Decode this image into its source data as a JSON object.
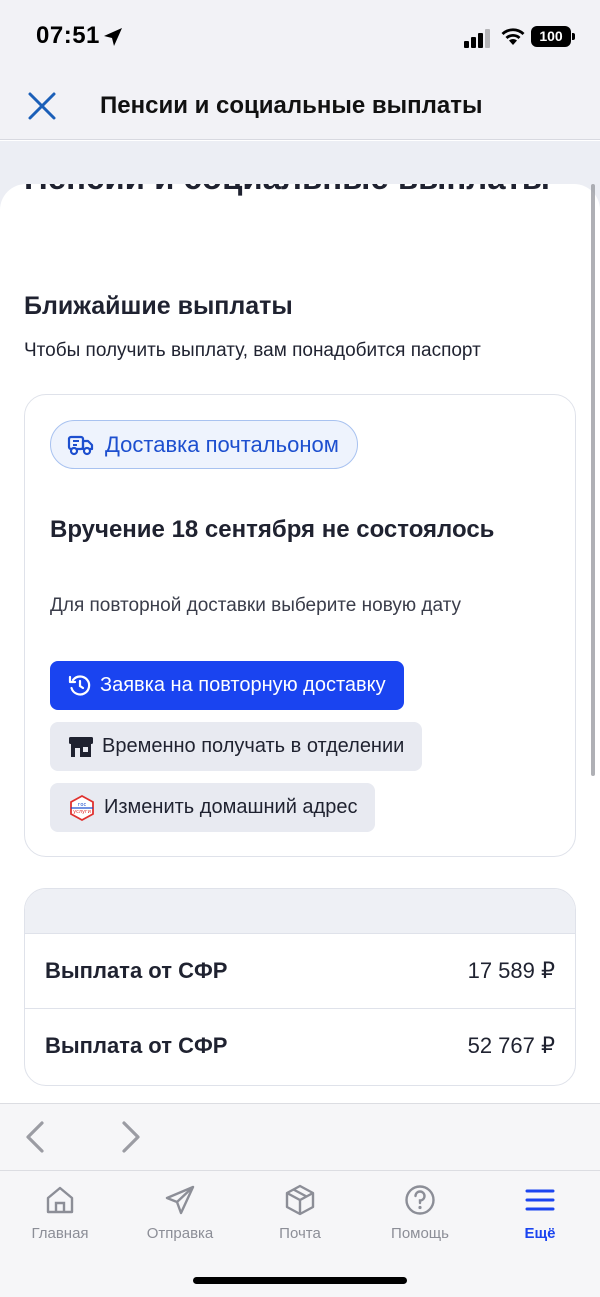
{
  "status_bar": {
    "time": "07:51",
    "battery": "100"
  },
  "header": {
    "title": "Пенсии и социальные выплаты"
  },
  "page": {
    "title": "Пенсии и социальные выплаты",
    "section_title": "Ближайшие выплаты",
    "section_subtitle": "Чтобы получить выплату, вам понадобится паспорт"
  },
  "card": {
    "chip_label": "Доставка почтальоном",
    "heading": "Вручение 18 сентября не состоялось",
    "subtitle": "Для повторной доставки выберите новую дату",
    "buttons": {
      "redelivery": "Заявка на повторную доставку",
      "branch": "Временно получать в отделении",
      "address": "Изменить домашний адрес"
    }
  },
  "payments": [
    {
      "label": "Выплата от СФР",
      "amount": "17 589 ₽"
    },
    {
      "label": "Выплата от СФР",
      "amount": "52 767 ₽"
    }
  ],
  "tabs": [
    {
      "label": "Главная",
      "icon": "home-icon"
    },
    {
      "label": "Отправка",
      "icon": "send-icon"
    },
    {
      "label": "Почта",
      "icon": "box-icon"
    },
    {
      "label": "Помощь",
      "icon": "help-icon"
    },
    {
      "label": "Ещё",
      "icon": "menu-icon",
      "active": true
    }
  ],
  "colors": {
    "accent": "#1a44f0",
    "chip_text": "#1d4fcf"
  }
}
